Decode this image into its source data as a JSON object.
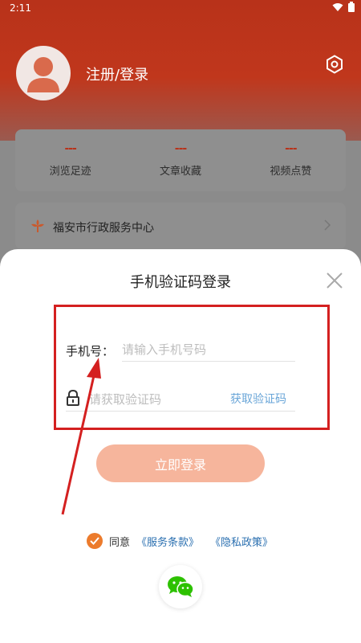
{
  "status_bar": {
    "time": "2:11"
  },
  "header": {
    "login_link": "注册/登录"
  },
  "stats": [
    {
      "value": "---",
      "label": "浏览足迹"
    },
    {
      "value": "---",
      "label": "文章收藏"
    },
    {
      "value": "---",
      "label": "视频点赞"
    }
  ],
  "service": {
    "label": "福安市行政服务中心"
  },
  "login_sheet": {
    "title": "手机验证码登录",
    "phone_label": "手机号：",
    "phone_placeholder": "请输入手机号码",
    "code_placeholder": "请获取验证码",
    "get_code": "获取验证码",
    "submit": "立即登录",
    "agree": "同意",
    "terms": "《服务条款》",
    "privacy": "《隐私政策》"
  },
  "colors": {
    "brand_red": "#b8321a",
    "button_peach": "#f6b59c",
    "link_blue": "#6aa6d8",
    "highlight_red": "#d42020",
    "check_orange": "#ec7b2c",
    "wechat_green": "#2dc100"
  },
  "icons": [
    "wifi-icon",
    "battery-icon",
    "avatar-icon",
    "settings-icon",
    "flower-icon",
    "chevron-right-icon",
    "close-icon",
    "lock-icon",
    "check-icon",
    "wechat-icon"
  ]
}
